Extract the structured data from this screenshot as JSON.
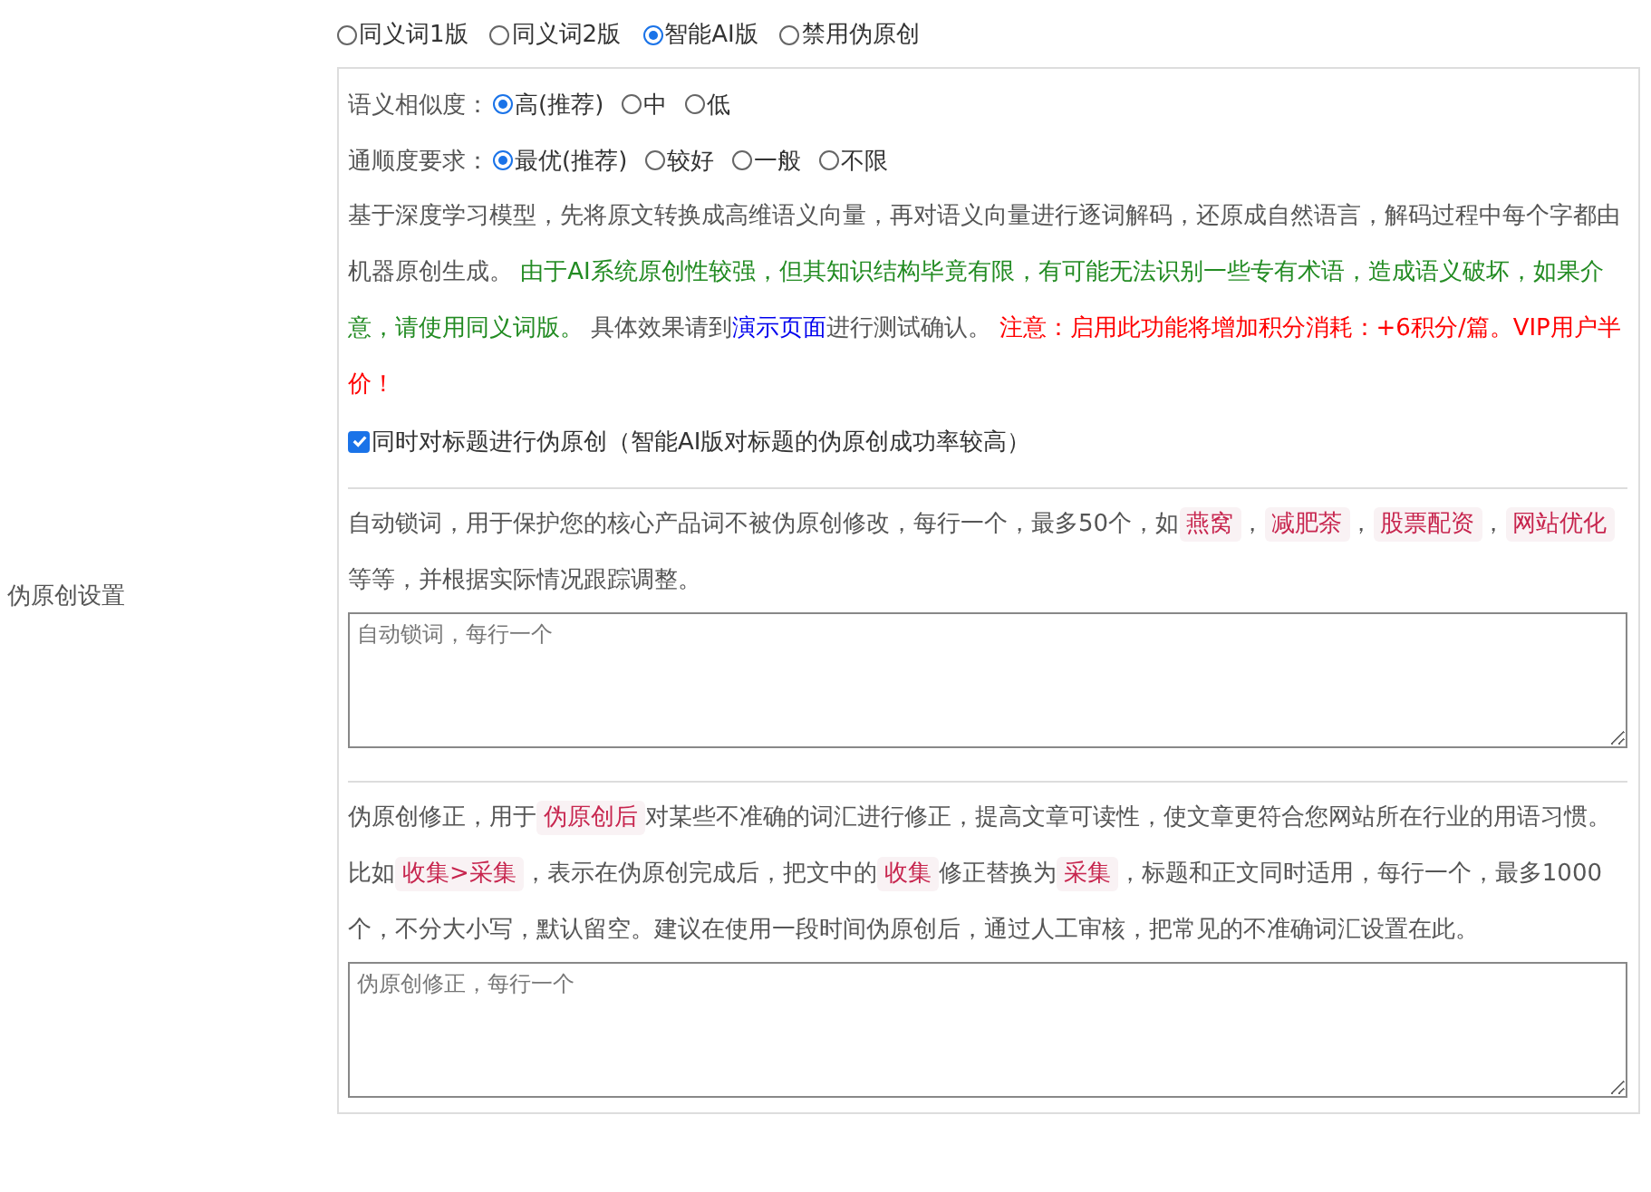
{
  "label": "伪原创设置",
  "modes": [
    {
      "label": "同义词1版",
      "selected": false
    },
    {
      "label": "同义词2版",
      "selected": false
    },
    {
      "label": "智能AI版",
      "selected": true
    },
    {
      "label": "禁用伪原创",
      "selected": false
    }
  ],
  "similarity": {
    "label": "语义相似度：",
    "options": [
      {
        "label": "高(推荐)",
        "selected": true
      },
      {
        "label": "中",
        "selected": false
      },
      {
        "label": "低",
        "selected": false
      }
    ]
  },
  "fluency": {
    "label": "通顺度要求：",
    "options": [
      {
        "label": "最优(推荐)",
        "selected": true
      },
      {
        "label": "较好",
        "selected": false
      },
      {
        "label": "一般",
        "selected": false
      },
      {
        "label": "不限",
        "selected": false
      }
    ]
  },
  "ai_description": [
    {
      "kind": "text",
      "text": "基于深度学习模型，先将原文转换成高维语义向量，再对语义向量进行逐词解码，还原成自然语言，解码过程中每个字都由机器原创生成。 "
    },
    {
      "kind": "notice",
      "text": "由于AI系统原创性较强，但其知识结构毕竟有限，有可能无法识别一些专有术语，造成语义破坏，如果介意，请使用同义词版。"
    },
    {
      "kind": "text",
      "text": " 具体效果请到"
    },
    {
      "kind": "link",
      "text": "演示页面"
    },
    {
      "kind": "text",
      "text": "进行测试确认。 "
    },
    {
      "kind": "warning",
      "text": "注意：启用此功能将增加积分消耗：+6积分/篇。VIP用户半价！"
    }
  ],
  "title_option": {
    "label": "同时对标题进行伪原创（智能AI版对标题的伪原创成功率较高）",
    "checked": true
  },
  "lock_words": {
    "description": [
      {
        "kind": "text",
        "text": "自动锁词，用于保护您的核心产品词不被伪原创修改，每行一个，最多50个，如"
      },
      {
        "kind": "code",
        "text": "燕窝"
      },
      {
        "kind": "text",
        "text": "，"
      },
      {
        "kind": "code",
        "text": "减肥茶"
      },
      {
        "kind": "text",
        "text": "，"
      },
      {
        "kind": "code",
        "text": "股票配资"
      },
      {
        "kind": "text",
        "text": "，"
      },
      {
        "kind": "code",
        "text": "网站优化"
      },
      {
        "kind": "text",
        "text": "等等，并根据实际情况跟踪调整。"
      }
    ],
    "placeholder": "自动锁词，每行一个"
  },
  "corrections": {
    "description": [
      {
        "kind": "text",
        "text": "伪原创修正，用于"
      },
      {
        "kind": "code",
        "text": "伪原创后"
      },
      {
        "kind": "text",
        "text": "对某些不准确的词汇进行修正，提高文章可读性，使文章更符合您网站所在行业的用语习惯。比如"
      },
      {
        "kind": "code",
        "text": "收集>采集"
      },
      {
        "kind": "text",
        "text": "，表示在伪原创完成后，把文中的"
      },
      {
        "kind": "code",
        "text": "收集"
      },
      {
        "kind": "text",
        "text": "修正替换为"
      },
      {
        "kind": "code",
        "text": "采集"
      },
      {
        "kind": "text",
        "text": "，标题和正文同时适用，每行一个，最多1000个，不分大小写，默认留空。建议在使用一段时间伪原创后，通过人工审核，把常见的不准确词汇设置在此。"
      }
    ],
    "placeholder": "伪原创修正，每行一个"
  }
}
